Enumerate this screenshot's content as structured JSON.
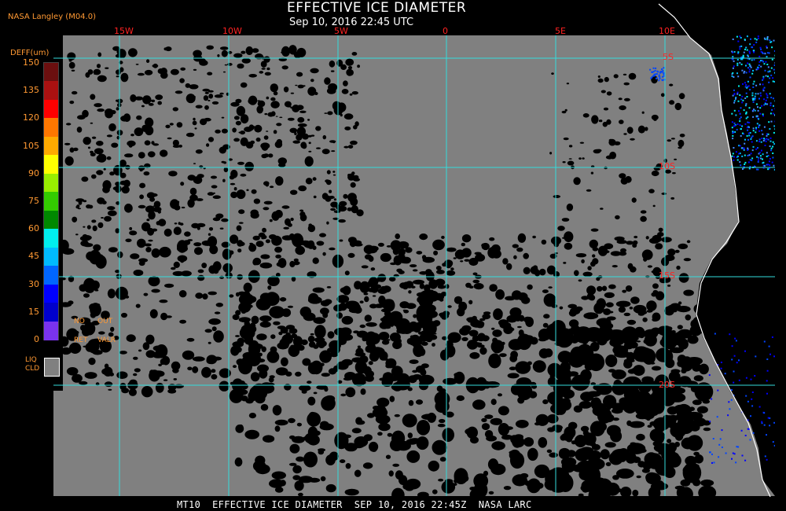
{
  "header": {
    "title": "EFFECTIVE ICE DIAMETER",
    "subtitle": "Sep 10, 2016 22:45 UTC",
    "org": "NASA Langley (M04.0)"
  },
  "footer": {
    "text": "MT10  EFFECTIVE ICE DIAMETER  SEP 10, 2016 22:45Z  NASA LARC"
  },
  "colorbar": {
    "title": "DEFF(um)",
    "ticks": [
      "150",
      "135",
      "120",
      "105",
      "90",
      "75",
      "60",
      "45",
      "30",
      "15",
      "0"
    ],
    "colors": [
      "#6b0f0f",
      "#aa1111",
      "#ff0000",
      "#ff7700",
      "#ffaa00",
      "#ffff00",
      "#99ee00",
      "#33cc00",
      "#008800",
      "#00eeee",
      "#00bbff",
      "#0066ff",
      "#0000ff",
      "#0000cc",
      "#7a33ee"
    ],
    "no_retrieval": {
      "line1": "NO",
      "line2": "RET"
    },
    "out_of_range": {
      "line1": "OUT",
      "line2": "VALR"
    },
    "liquid_cloud": {
      "line1": "LIQ",
      "line2": "CLD",
      "color": "#808080"
    }
  },
  "map": {
    "longitude_labels": [
      "15W",
      "10W",
      "5W",
      "0",
      "5E",
      "10E"
    ],
    "latitude_labels": [
      "5S",
      "10S",
      "15S",
      "20S"
    ],
    "grid_color": "#33dddd",
    "cloud_color": "#808080",
    "background_color": "#000000",
    "coast_color": "#ffffff"
  }
}
